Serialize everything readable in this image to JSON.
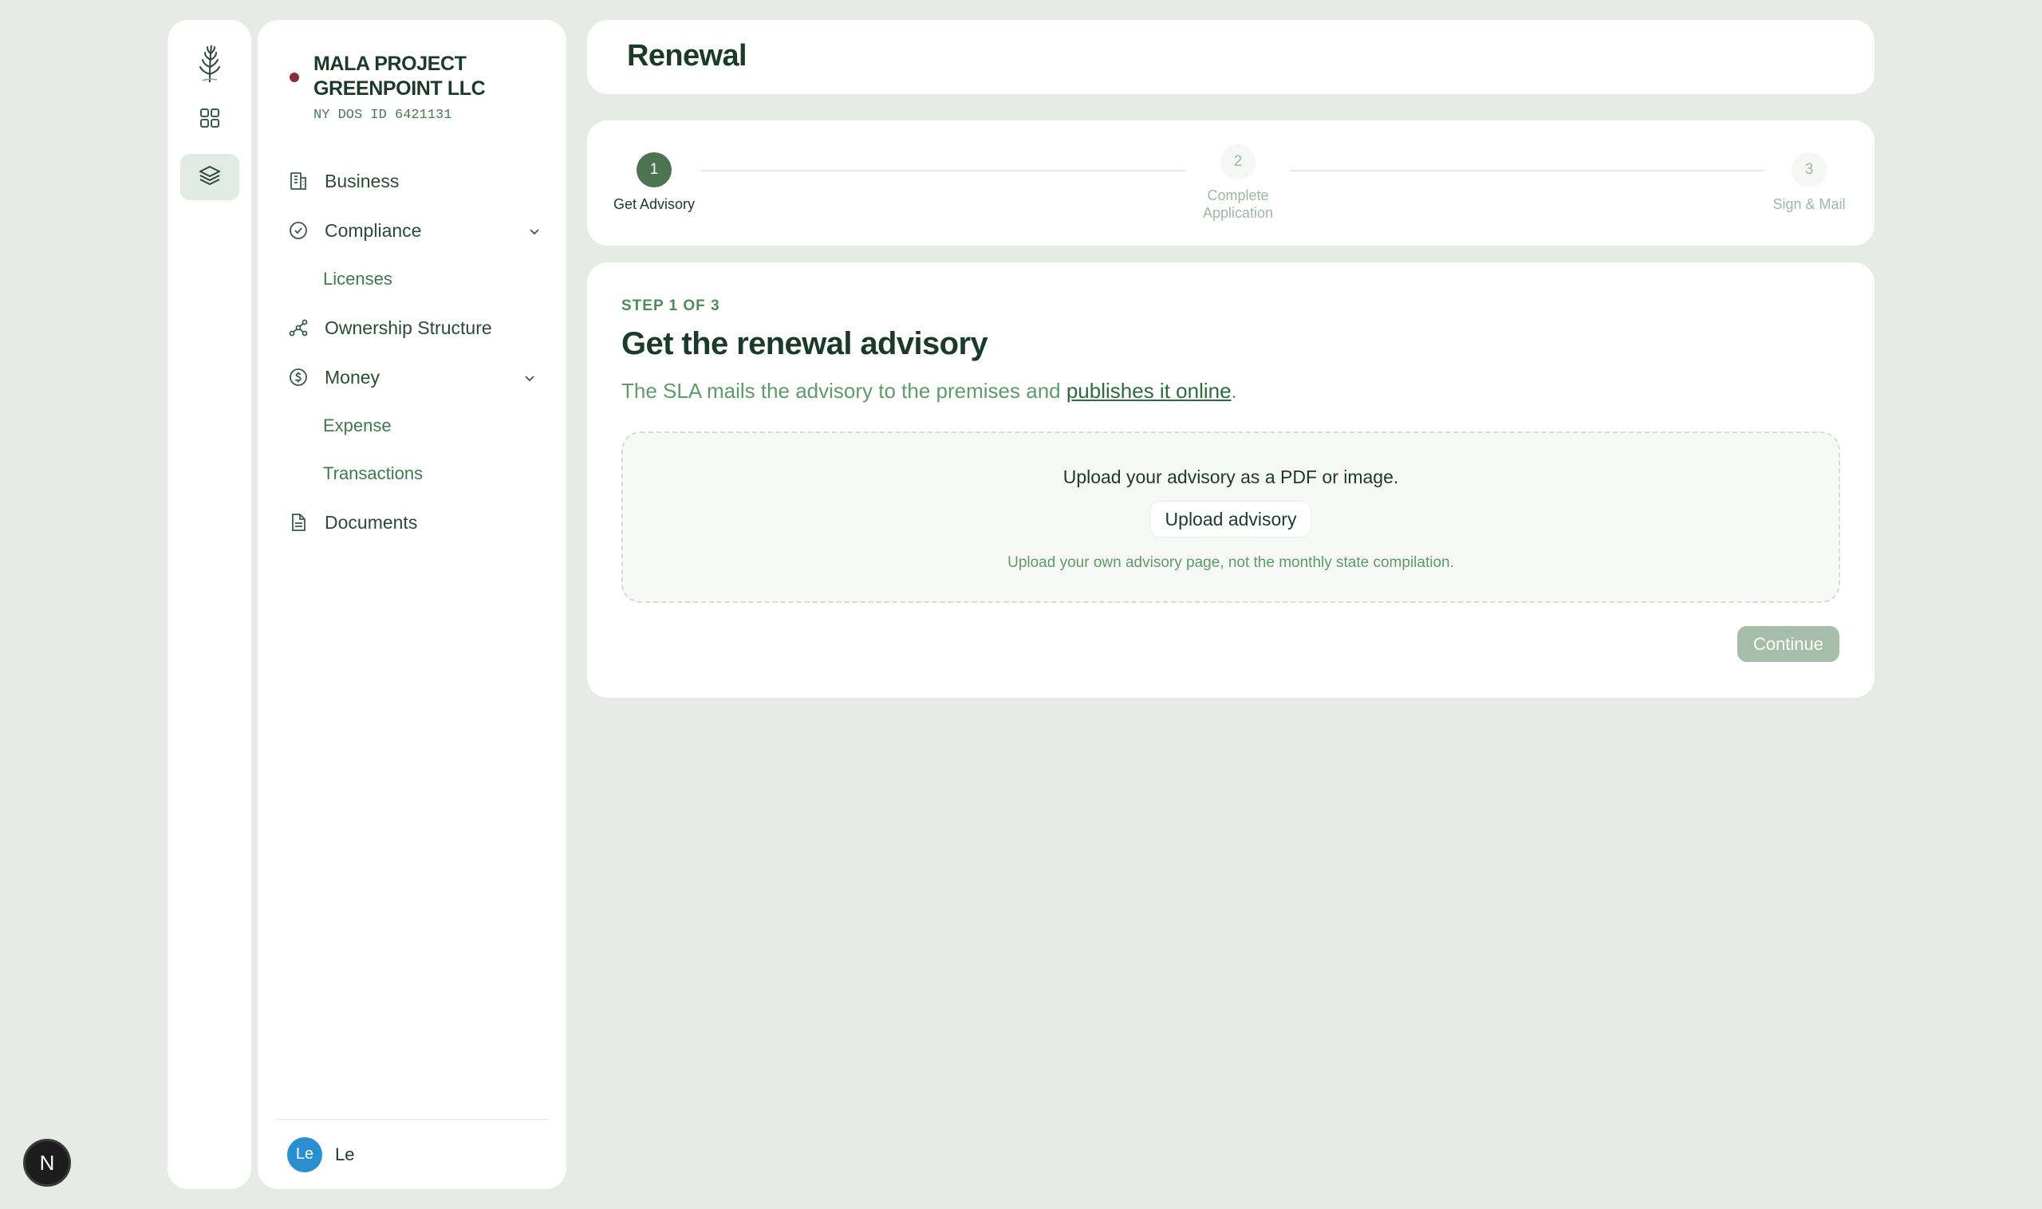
{
  "colors": {
    "background": "#e6ebe6",
    "accent": "#4c7352",
    "status_dot": "#8a2d3a",
    "avatar": "#2a8fd0",
    "continue_disabled": "#a6bda9"
  },
  "rail": {
    "icons": [
      "fern-logo-icon",
      "grid-icon",
      "layers-icon"
    ],
    "active": "layers-icon"
  },
  "company": {
    "name_line1": "MALA PROJECT",
    "name_line2": "GREENPOINT LLC",
    "id": "NY DOS ID 6421131"
  },
  "nav": {
    "business": "Business",
    "compliance": "Compliance",
    "licenses": "Licenses",
    "ownership": "Ownership Structure",
    "money": "Money",
    "expense": "Expense",
    "transactions": "Transactions",
    "documents": "Documents"
  },
  "user": {
    "initials": "Le",
    "name": "Le"
  },
  "header": {
    "title": "Renewal"
  },
  "stepper": {
    "steps": [
      {
        "number": "1",
        "label": "Get Advisory",
        "state": "active"
      },
      {
        "number": "2",
        "label_line1": "Complete",
        "label_line2": "Application",
        "state": "upcoming"
      },
      {
        "number": "3",
        "label": "Sign & Mail",
        "state": "upcoming"
      }
    ]
  },
  "content": {
    "eyebrow": "STEP 1 OF 3",
    "title": "Get the renewal advisory",
    "desc_prefix": "The SLA mails the advisory to the premises and ",
    "desc_link": "publishes it online",
    "desc_suffix": ".",
    "upload_prompt": "Upload your advisory as a PDF or image.",
    "upload_button": "Upload advisory",
    "upload_hint": "Upload your own advisory page, not the monthly state compilation.",
    "continue": "Continue"
  },
  "fab": {
    "label": "N"
  }
}
